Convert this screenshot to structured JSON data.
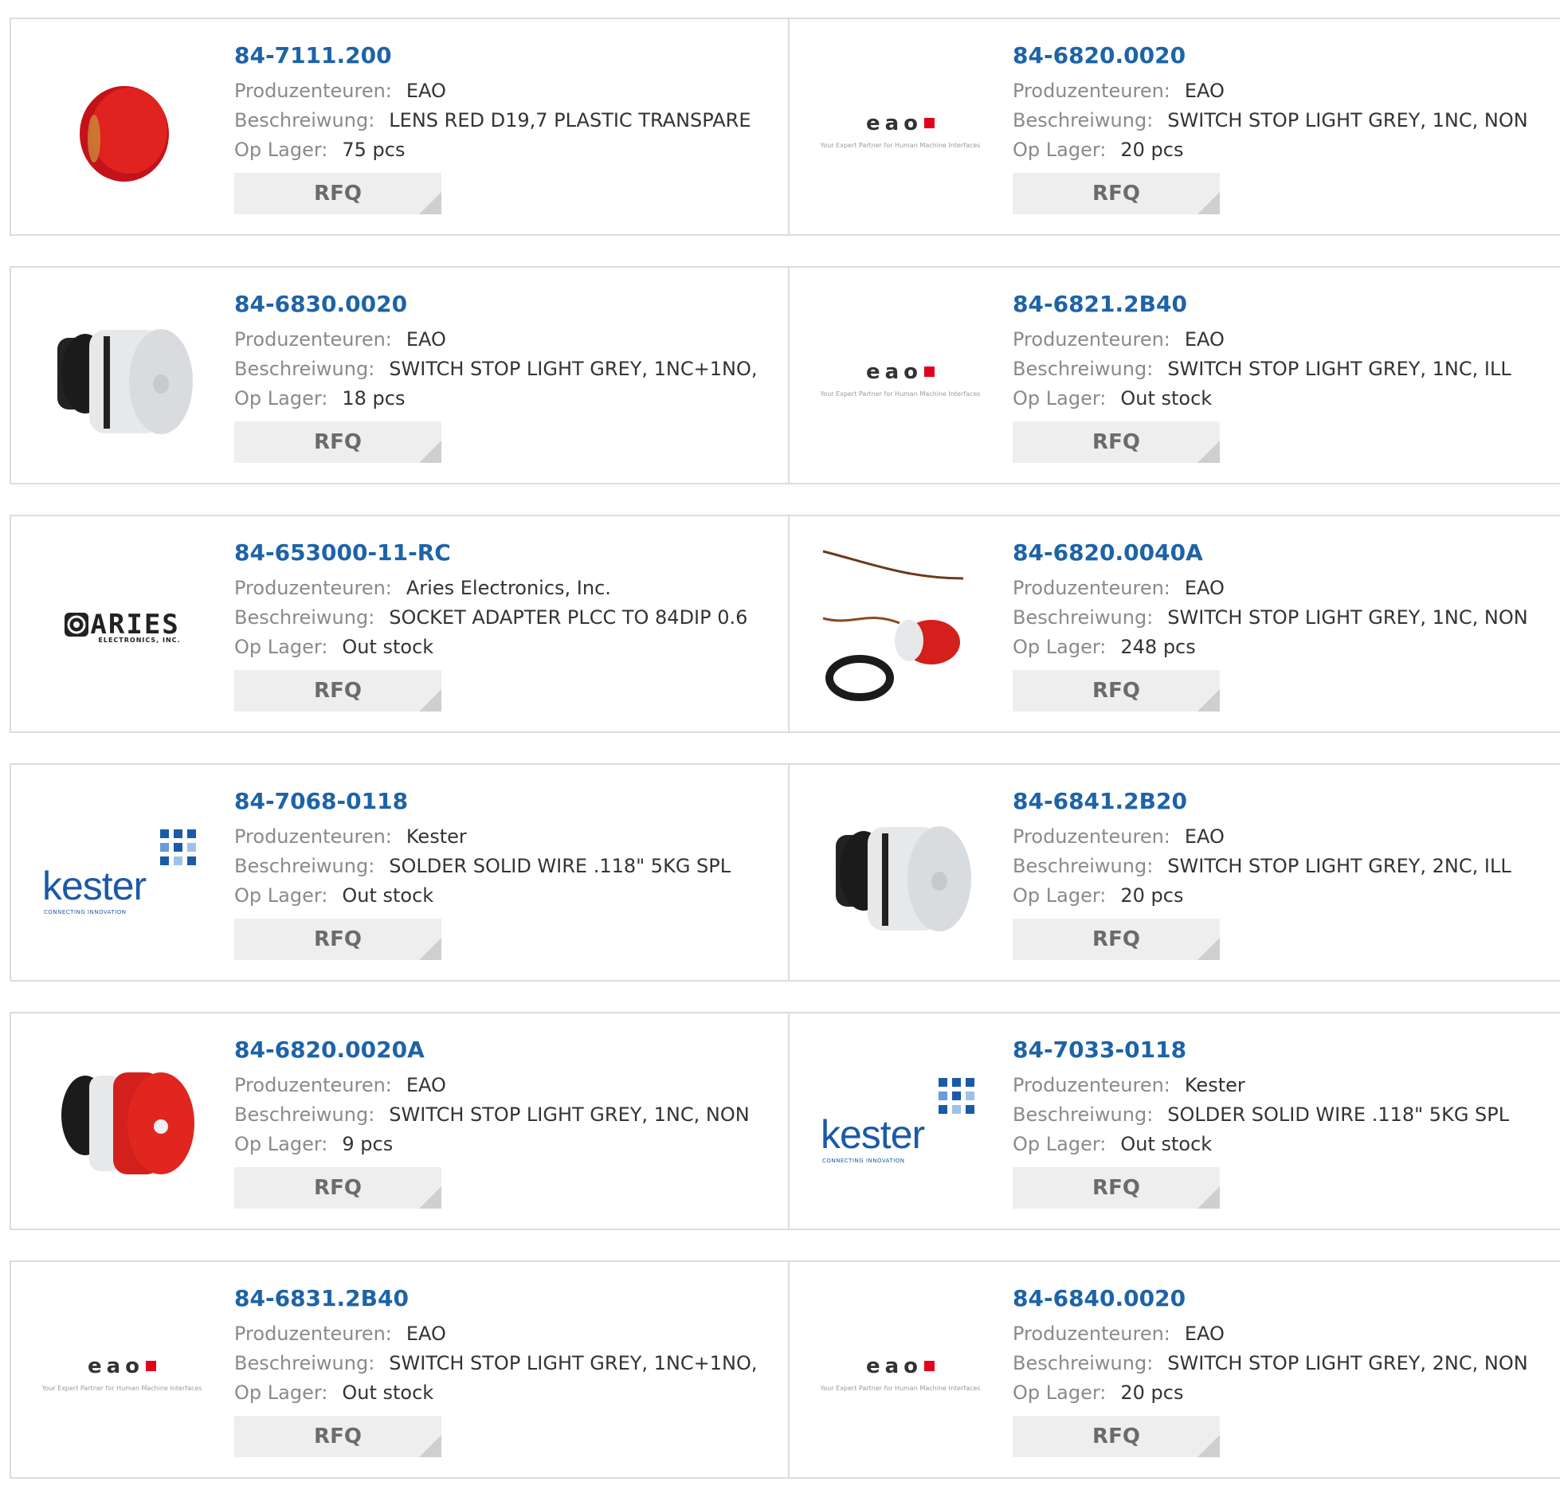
{
  "labels": {
    "manufacturer": "Produzenteuren:",
    "description": "Beschreiwung:",
    "stock": "Op Lager:",
    "rfq": "RFQ"
  },
  "logos": {
    "eao_word": "eao",
    "eao_tagline": "Your Expert Partner for Human Machine Interfaces",
    "aries_word": "ARIES",
    "aries_sub": "ELECTRONICS, INC.",
    "kester_word": "kester",
    "kester_tagline": "CONNECTING INNOVATION"
  },
  "products": [
    {
      "part": "84-7111.200",
      "manufacturer": "EAO",
      "description": "LENS RED D19,7 PLASTIC TRANSPARE",
      "stock": "75 pcs",
      "image": "red-lens-photo"
    },
    {
      "part": "84-6820.0020",
      "manufacturer": "EAO",
      "description": "SWITCH STOP LIGHT GREY, 1NC, NON",
      "stock": "20 pcs",
      "image": "eao-logo"
    },
    {
      "part": "84-6830.0020",
      "manufacturer": "EAO",
      "description": "SWITCH STOP LIGHT GREY, 1NC+1NO,",
      "stock": "18 pcs",
      "image": "grey-switch-photo"
    },
    {
      "part": "84-6821.2B40",
      "manufacturer": "EAO",
      "description": "SWITCH STOP LIGHT GREY, 1NC, ILL",
      "stock": "Out stock",
      "image": "eao-logo"
    },
    {
      "part": "84-653000-11-RC",
      "manufacturer": "Aries Electronics, Inc.",
      "description": "SOCKET ADAPTER PLCC TO 84DIP 0.6",
      "stock": "Out stock",
      "image": "aries-logo"
    },
    {
      "part": "84-6820.0040A",
      "manufacturer": "EAO",
      "description": "SWITCH STOP LIGHT GREY, 1NC, NON",
      "stock": "248 pcs",
      "image": "red-switch-wires-photo"
    },
    {
      "part": "84-7068-0118",
      "manufacturer": "Kester",
      "description": "SOLDER SOLID WIRE .118\" 5KG SPL",
      "stock": "Out stock",
      "image": "kester-logo"
    },
    {
      "part": "84-6841.2B20",
      "manufacturer": "EAO",
      "description": "SWITCH STOP LIGHT GREY, 2NC, ILL",
      "stock": "20 pcs",
      "image": "grey-switch-photo"
    },
    {
      "part": "84-6820.0020A",
      "manufacturer": "EAO",
      "description": "SWITCH STOP LIGHT GREY, 1NC, NON",
      "stock": "9 pcs",
      "image": "red-switch-photo"
    },
    {
      "part": "84-7033-0118",
      "manufacturer": "Kester",
      "description": "SOLDER SOLID WIRE .118\" 5KG SPL",
      "stock": "Out stock",
      "image": "kester-logo"
    },
    {
      "part": "84-6831.2B40",
      "manufacturer": "EAO",
      "description": "SWITCH STOP LIGHT GREY, 1NC+1NO,",
      "stock": "Out stock",
      "image": "eao-logo"
    },
    {
      "part": "84-6840.0020",
      "manufacturer": "EAO",
      "description": "SWITCH STOP LIGHT GREY, 2NC, NON",
      "stock": "20 pcs",
      "image": "eao-logo"
    }
  ],
  "colors": {
    "part_link": "#1d63a8",
    "label": "#8a8a8a",
    "value": "#333333",
    "rfq_bg": "#eeeeee",
    "border": "#dcdcdc"
  }
}
